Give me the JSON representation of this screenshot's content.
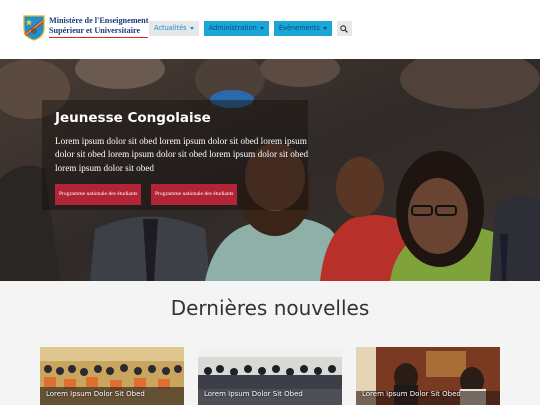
{
  "header": {
    "logo": {
      "line1": "Ministère de l'Enseignement",
      "line2": "Supérieur et Universitaire",
      "emblem_icon": "drc-coat-of-arms-icon"
    },
    "nav": [
      {
        "label": "Actualités",
        "style": "grey"
      },
      {
        "label": "Administration",
        "style": "blue"
      },
      {
        "label": "Évènements",
        "style": "blue"
      }
    ],
    "search_icon": "search-icon"
  },
  "hero": {
    "title": "Jeunesse Congolaise",
    "text": "Lorem ipsum dolor sit obed lorem ipsum dolor sit obed lorem ipsum dolor sit obed lorem ipsum dolor sit obed lorem ipsum dolor sit obed lorem ipsum dolor sit obed",
    "buttons": [
      "Programme nationale des étudiants",
      "Programme nationale des étudiants"
    ]
  },
  "news": {
    "title": "Dernières nouvelles",
    "cards": [
      {
        "caption": "Lorem Ipsum Dolor Sit Obed"
      },
      {
        "caption": "Lorem Ipsum Dolor Sit Obed"
      },
      {
        "caption": "Lorem Ipsum Dolor Sit Obed"
      }
    ]
  },
  "colors": {
    "accent_blue": "#19a7d8",
    "button_red": "#b32436",
    "logo_blue": "#1a3a7a"
  }
}
